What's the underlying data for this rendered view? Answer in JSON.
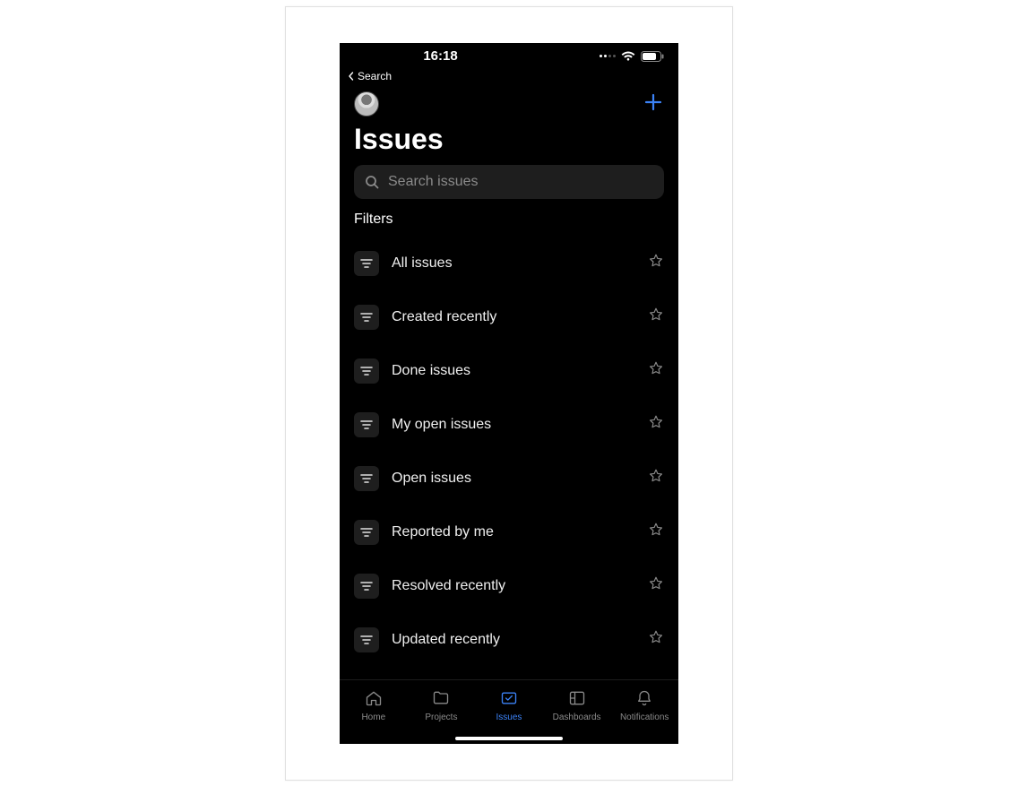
{
  "status": {
    "time": "16:18",
    "back_label": "Search"
  },
  "header": {
    "title": "Issues"
  },
  "search": {
    "placeholder": "Search issues"
  },
  "filters_section_label": "Filters",
  "filters": [
    {
      "label": "All issues"
    },
    {
      "label": "Created recently"
    },
    {
      "label": "Done issues"
    },
    {
      "label": "My open issues"
    },
    {
      "label": "Open issues"
    },
    {
      "label": "Reported by me"
    },
    {
      "label": "Resolved recently"
    },
    {
      "label": "Updated recently"
    }
  ],
  "tabs": [
    {
      "label": "Home"
    },
    {
      "label": "Projects"
    },
    {
      "label": "Issues"
    },
    {
      "label": "Dashboards"
    },
    {
      "label": "Notifications"
    }
  ],
  "active_tab": "Issues"
}
